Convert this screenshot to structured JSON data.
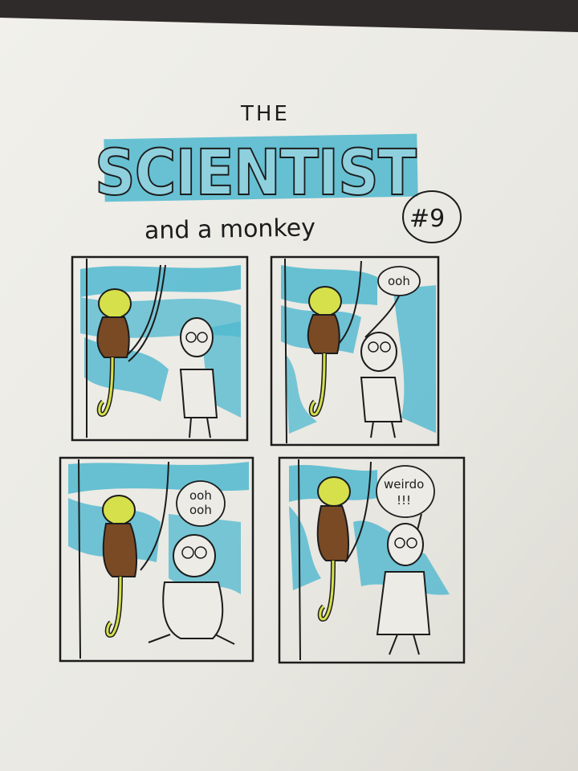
{
  "comic": {
    "title_top": "THE",
    "title_main": "SCIENTIST",
    "subtitle": "and a monkey",
    "issue": "#9"
  },
  "panels": [
    {
      "speech": []
    },
    {
      "speech": [
        "ooh"
      ]
    },
    {
      "speech": [
        "ooh",
        "ooh"
      ]
    },
    {
      "speech": [
        "weirdo",
        "!!!"
      ]
    }
  ],
  "colors": {
    "paper": "#ecebe6",
    "background": "#2f2b2a",
    "highlighter_blue": "#4fb8cf",
    "monkey_yellow": "#d6e04a",
    "monkey_brown": "#7a4a25",
    "ink": "#1c1c1c"
  }
}
